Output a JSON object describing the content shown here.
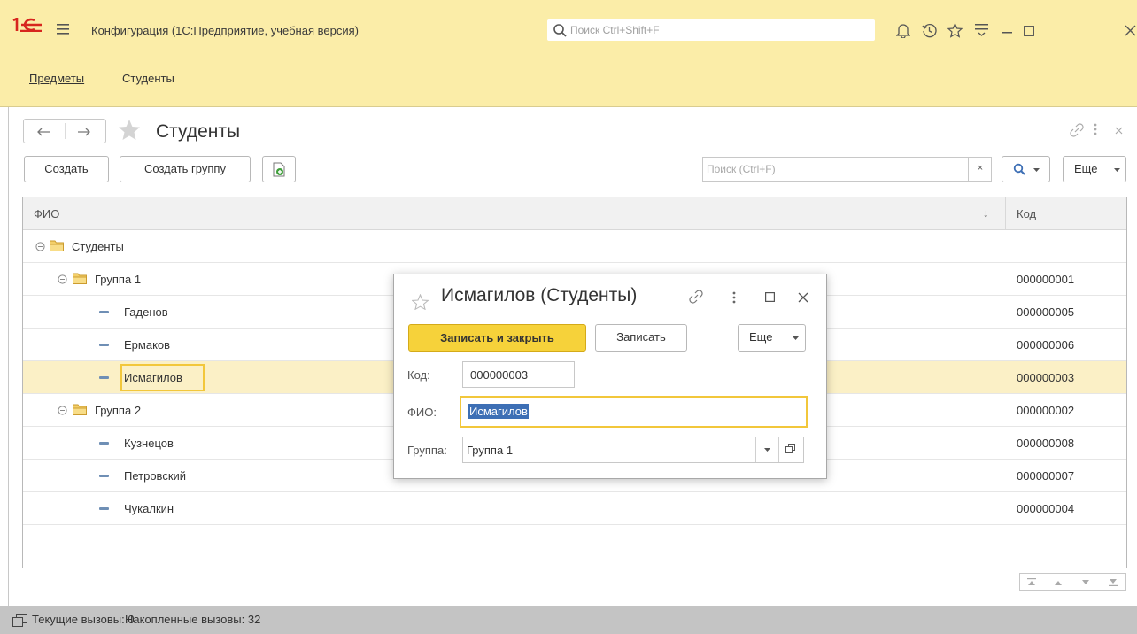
{
  "app": {
    "title": "Конфигурация  (1С:Предприятие, учебная версия)",
    "global_search_placeholder": "Поиск Ctrl+Shift+F"
  },
  "sections": {
    "items": [
      {
        "label": "Предметы",
        "active": true
      },
      {
        "label": "Студенты",
        "active": false
      }
    ]
  },
  "form": {
    "title": "Студенты",
    "toolbar": {
      "create_label": "Создать",
      "create_group_label": "Создать группу",
      "search_placeholder": "Поиск (Ctrl+F)",
      "clear_label": "×",
      "more_label": "Еще"
    },
    "table": {
      "columns": [
        "ФИО",
        "Код"
      ],
      "sort_indicator": "↓",
      "rows": [
        {
          "name": "Студенты",
          "code": "",
          "kind": "group",
          "level": 0
        },
        {
          "name": "Группа 1",
          "code": "000000001",
          "kind": "group",
          "level": 1
        },
        {
          "name": "Гаденов",
          "code": "000000005",
          "kind": "item",
          "level": 2
        },
        {
          "name": "Ермаков",
          "code": "000000006",
          "kind": "item",
          "level": 2
        },
        {
          "name": "Исмагилов",
          "code": "000000003",
          "kind": "item",
          "level": 2,
          "selected": true
        },
        {
          "name": "Группа 2",
          "code": "000000002",
          "kind": "group",
          "level": 1
        },
        {
          "name": "Кузнецов",
          "code": "000000008",
          "kind": "item",
          "level": 2
        },
        {
          "name": "Петровский",
          "code": "000000007",
          "kind": "item",
          "level": 2
        },
        {
          "name": "Чукалкин",
          "code": "000000004",
          "kind": "item",
          "level": 2
        }
      ]
    }
  },
  "dialog": {
    "title": "Исмагилов (Студенты)",
    "save_close_label": "Записать и закрыть",
    "save_label": "Записать",
    "more_label": "Еще",
    "code_label": "Код:",
    "code_value": "000000003",
    "fio_label": "ФИО:",
    "fio_value": "Исмагилов",
    "group_label": "Группа:",
    "group_value": "Группа 1"
  },
  "status": {
    "current_calls": "Текущие вызовы: 0",
    "accumulated_calls": "Накопленные вызовы: 32"
  },
  "colors": {
    "accent_yellow": "#fbeda8",
    "primary_button": "#f6d23a",
    "selection_row": "#fbf0c6",
    "selection_border": "#f2c73b",
    "item_marker": "#6f8fb5"
  }
}
